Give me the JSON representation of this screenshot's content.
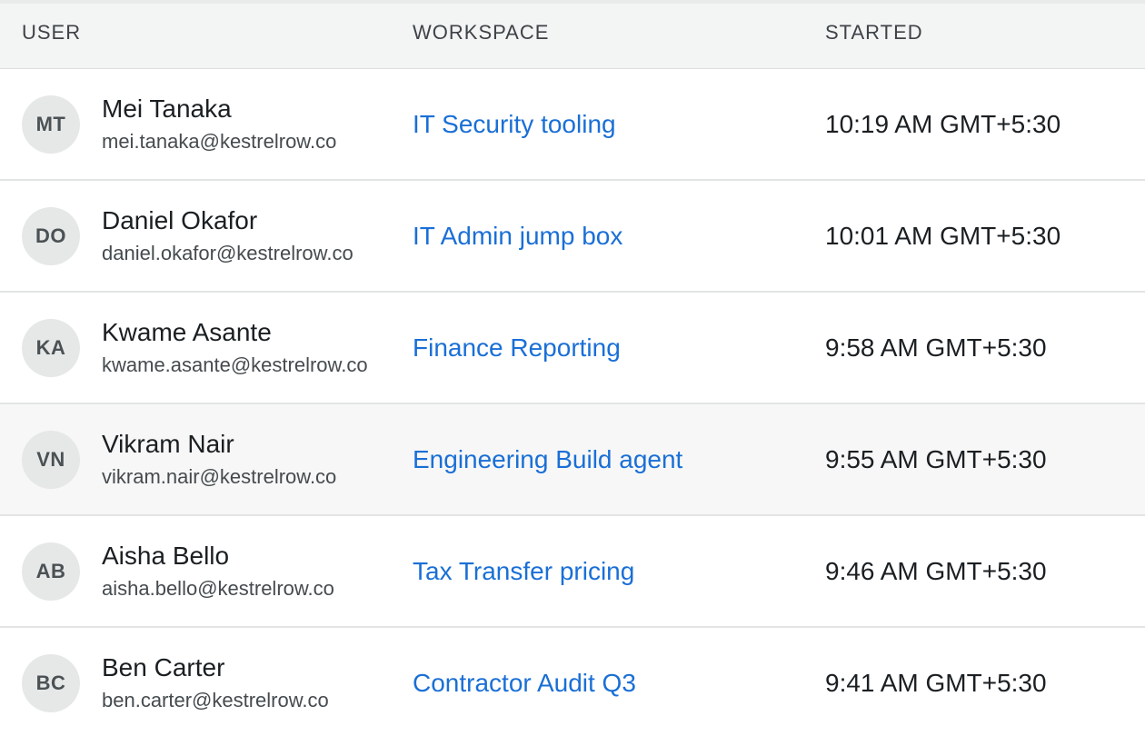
{
  "headers": {
    "user": "USER",
    "workspace": "WORKSPACE",
    "started": "STARTED"
  },
  "rows": [
    {
      "initials": "MT",
      "name": "Mei Tanaka",
      "email": "mei.tanaka@kestrelrow.co",
      "workspace": "IT Security tooling",
      "started": "10:19 AM GMT+5:30"
    },
    {
      "initials": "DO",
      "name": "Daniel Okafor",
      "email": "daniel.okafor@kestrelrow.co",
      "workspace": "IT Admin jump box",
      "started": "10:01 AM GMT+5:30"
    },
    {
      "initials": "KA",
      "name": "Kwame Asante",
      "email": "kwame.asante@kestrelrow.co",
      "workspace": "Finance Reporting",
      "started": "9:58 AM GMT+5:30"
    },
    {
      "initials": "VN",
      "name": "Vikram Nair",
      "email": "vikram.nair@kestrelrow.co",
      "workspace": "Engineering Build agent",
      "started": "9:55 AM GMT+5:30"
    },
    {
      "initials": "AB",
      "name": "Aisha Bello",
      "email": "aisha.bello@kestrelrow.co",
      "workspace": "Tax Transfer pricing",
      "started": "9:46 AM GMT+5:30"
    },
    {
      "initials": "BC",
      "name": "Ben Carter",
      "email": "ben.carter@kestrelrow.co",
      "workspace": "Contractor Audit Q3",
      "started": "9:41 AM GMT+5:30"
    }
  ]
}
